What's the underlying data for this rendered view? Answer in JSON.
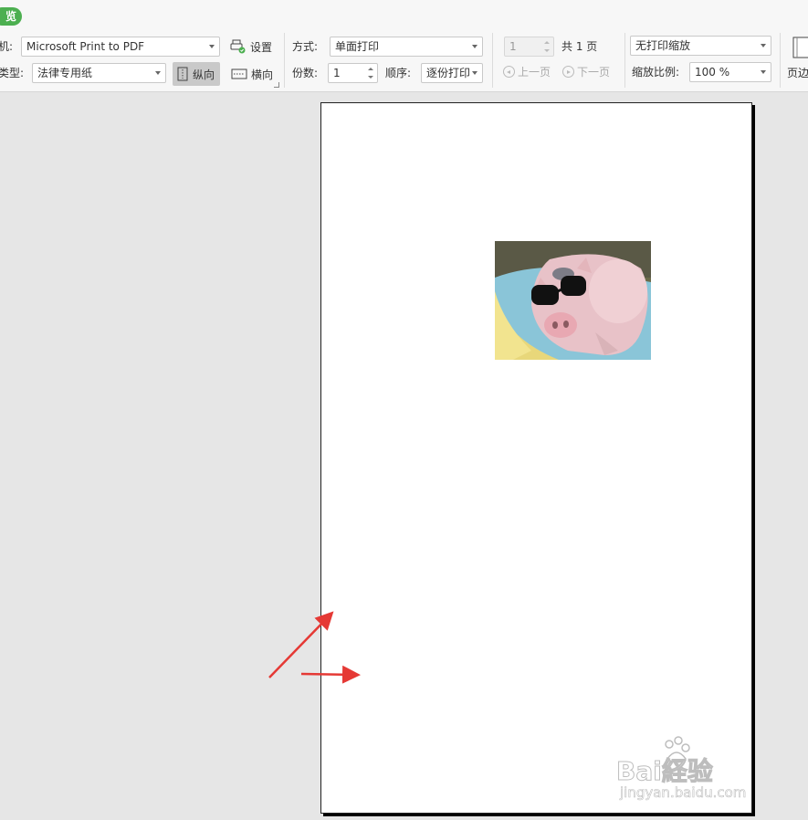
{
  "toolbar": {
    "preview_tab": "览",
    "printer_label": "机:",
    "printer_value": "Microsoft Print to PDF",
    "paper_label": "类型:",
    "paper_value": "法律专用纸",
    "settings_label": "设置",
    "portrait_label": "纵向",
    "landscape_label": "横向",
    "mode_label": "方式:",
    "mode_value": "单面打印",
    "copies_label": "份数:",
    "copies_value": "1",
    "order_label": "顺序:",
    "order_value": "逐份打印",
    "page_value": "1",
    "page_total": "共 1 页",
    "prev_page": "上一页",
    "next_page": "下一页",
    "scaling_value": "无打印缩放",
    "zoom_label": "缩放比例:",
    "zoom_value": "100 %",
    "margins_label": "页边"
  },
  "preview": {
    "photo_description": "pig-wearing-sunglasses-photo",
    "annotation_color": "#e53935"
  },
  "watermark": {
    "brand": "Bai経验",
    "url": "jingyan.baidu.com"
  }
}
